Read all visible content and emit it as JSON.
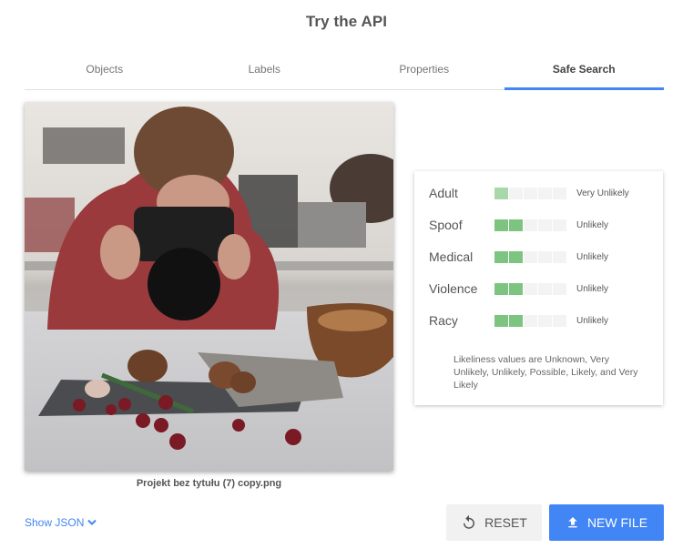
{
  "header": {
    "title": "Try the API"
  },
  "tabs": [
    {
      "label": "Objects",
      "active": false
    },
    {
      "label": "Labels",
      "active": false
    },
    {
      "label": "Properties",
      "active": false
    },
    {
      "label": "Safe Search",
      "active": true
    }
  ],
  "image": {
    "filename": "Projekt bez tytułu (7) copy.png",
    "description": "Woman photographing mushrooms, rosemary, garlic and cranberries on a slate board in a kitchen"
  },
  "safe_search": {
    "rows": [
      {
        "label": "Adult",
        "value": "Very Unlikely",
        "level": 1,
        "of": 5
      },
      {
        "label": "Spoof",
        "value": "Unlikely",
        "level": 2,
        "of": 5
      },
      {
        "label": "Medical",
        "value": "Unlikely",
        "level": 2,
        "of": 5
      },
      {
        "label": "Violence",
        "value": "Unlikely",
        "level": 2,
        "of": 5
      },
      {
        "label": "Racy",
        "value": "Unlikely",
        "level": 2,
        "of": 5
      }
    ],
    "note": "Likeliness values are Unknown, Very Unlikely, Unlikely, Possible, Likely, and Very Likely",
    "colors": {
      "very_unlikely": "#a8d8aa",
      "unlikely": "#7cc47f",
      "empty": "#f3f3f3"
    }
  },
  "footer": {
    "show_json_label": "Show JSON",
    "reset_label": "RESET",
    "new_file_label": "NEW FILE",
    "accent": "#4285f4"
  }
}
